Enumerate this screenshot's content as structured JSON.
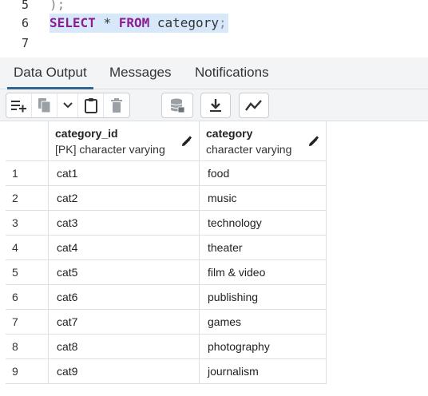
{
  "editor": {
    "lines": [
      {
        "number": "5",
        "text": ");"
      },
      {
        "number": "6",
        "keyword1": "SELECT",
        "op": "*",
        "keyword2": "FROM",
        "ident": "category",
        "punct": ";"
      },
      {
        "number": "7",
        "text": ""
      }
    ]
  },
  "tabs": [
    {
      "label": "Data Output"
    },
    {
      "label": "Messages"
    },
    {
      "label": "Notifications"
    }
  ],
  "toolbar": {
    "icons": [
      "add-row-icon",
      "copy-icon",
      "chevron-down-icon",
      "paste-icon",
      "delete-icon",
      "save-data-icon",
      "download-icon",
      "graph-icon"
    ]
  },
  "grid": {
    "columns": [
      {
        "name": "category_id",
        "type": "[PK] character varying"
      },
      {
        "name": "category",
        "type": "character varying"
      }
    ],
    "rows": [
      {
        "n": "1",
        "id": "cat1",
        "category": "food"
      },
      {
        "n": "2",
        "id": "cat2",
        "category": "music"
      },
      {
        "n": "3",
        "id": "cat3",
        "category": "technology"
      },
      {
        "n": "4",
        "id": "cat4",
        "category": "theater"
      },
      {
        "n": "5",
        "id": "cat5",
        "category": "film & video"
      },
      {
        "n": "6",
        "id": "cat6",
        "category": "publishing"
      },
      {
        "n": "7",
        "id": "cat7",
        "category": "games"
      },
      {
        "n": "8",
        "id": "cat8",
        "category": "photography"
      },
      {
        "n": "9",
        "id": "cat9",
        "category": "journalism"
      }
    ]
  },
  "colors": {
    "keyword": "#8a1d8f",
    "selection": "#d7e8fb",
    "active_tab": "#326690"
  }
}
